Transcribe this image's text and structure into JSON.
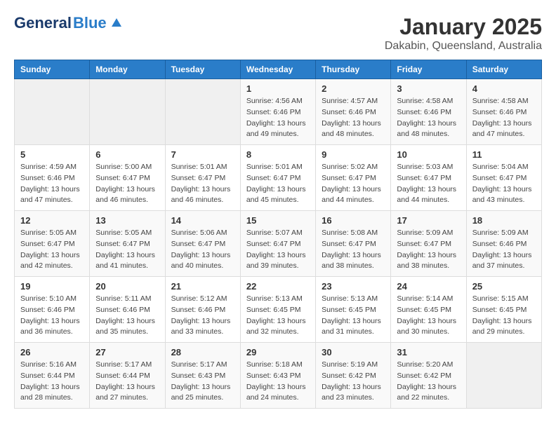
{
  "header": {
    "logo_general": "General",
    "logo_blue": "Blue",
    "month": "January 2025",
    "location": "Dakabin, Queensland, Australia"
  },
  "weekdays": [
    "Sunday",
    "Monday",
    "Tuesday",
    "Wednesday",
    "Thursday",
    "Friday",
    "Saturday"
  ],
  "weeks": [
    [
      {
        "day": "",
        "info": ""
      },
      {
        "day": "",
        "info": ""
      },
      {
        "day": "",
        "info": ""
      },
      {
        "day": "1",
        "info": "Sunrise: 4:56 AM\nSunset: 6:46 PM\nDaylight: 13 hours\nand 49 minutes."
      },
      {
        "day": "2",
        "info": "Sunrise: 4:57 AM\nSunset: 6:46 PM\nDaylight: 13 hours\nand 48 minutes."
      },
      {
        "day": "3",
        "info": "Sunrise: 4:58 AM\nSunset: 6:46 PM\nDaylight: 13 hours\nand 48 minutes."
      },
      {
        "day": "4",
        "info": "Sunrise: 4:58 AM\nSunset: 6:46 PM\nDaylight: 13 hours\nand 47 minutes."
      }
    ],
    [
      {
        "day": "5",
        "info": "Sunrise: 4:59 AM\nSunset: 6:46 PM\nDaylight: 13 hours\nand 47 minutes."
      },
      {
        "day": "6",
        "info": "Sunrise: 5:00 AM\nSunset: 6:47 PM\nDaylight: 13 hours\nand 46 minutes."
      },
      {
        "day": "7",
        "info": "Sunrise: 5:01 AM\nSunset: 6:47 PM\nDaylight: 13 hours\nand 46 minutes."
      },
      {
        "day": "8",
        "info": "Sunrise: 5:01 AM\nSunset: 6:47 PM\nDaylight: 13 hours\nand 45 minutes."
      },
      {
        "day": "9",
        "info": "Sunrise: 5:02 AM\nSunset: 6:47 PM\nDaylight: 13 hours\nand 44 minutes."
      },
      {
        "day": "10",
        "info": "Sunrise: 5:03 AM\nSunset: 6:47 PM\nDaylight: 13 hours\nand 44 minutes."
      },
      {
        "day": "11",
        "info": "Sunrise: 5:04 AM\nSunset: 6:47 PM\nDaylight: 13 hours\nand 43 minutes."
      }
    ],
    [
      {
        "day": "12",
        "info": "Sunrise: 5:05 AM\nSunset: 6:47 PM\nDaylight: 13 hours\nand 42 minutes."
      },
      {
        "day": "13",
        "info": "Sunrise: 5:05 AM\nSunset: 6:47 PM\nDaylight: 13 hours\nand 41 minutes."
      },
      {
        "day": "14",
        "info": "Sunrise: 5:06 AM\nSunset: 6:47 PM\nDaylight: 13 hours\nand 40 minutes."
      },
      {
        "day": "15",
        "info": "Sunrise: 5:07 AM\nSunset: 6:47 PM\nDaylight: 13 hours\nand 39 minutes."
      },
      {
        "day": "16",
        "info": "Sunrise: 5:08 AM\nSunset: 6:47 PM\nDaylight: 13 hours\nand 38 minutes."
      },
      {
        "day": "17",
        "info": "Sunrise: 5:09 AM\nSunset: 6:47 PM\nDaylight: 13 hours\nand 38 minutes."
      },
      {
        "day": "18",
        "info": "Sunrise: 5:09 AM\nSunset: 6:46 PM\nDaylight: 13 hours\nand 37 minutes."
      }
    ],
    [
      {
        "day": "19",
        "info": "Sunrise: 5:10 AM\nSunset: 6:46 PM\nDaylight: 13 hours\nand 36 minutes."
      },
      {
        "day": "20",
        "info": "Sunrise: 5:11 AM\nSunset: 6:46 PM\nDaylight: 13 hours\nand 35 minutes."
      },
      {
        "day": "21",
        "info": "Sunrise: 5:12 AM\nSunset: 6:46 PM\nDaylight: 13 hours\nand 33 minutes."
      },
      {
        "day": "22",
        "info": "Sunrise: 5:13 AM\nSunset: 6:45 PM\nDaylight: 13 hours\nand 32 minutes."
      },
      {
        "day": "23",
        "info": "Sunrise: 5:13 AM\nSunset: 6:45 PM\nDaylight: 13 hours\nand 31 minutes."
      },
      {
        "day": "24",
        "info": "Sunrise: 5:14 AM\nSunset: 6:45 PM\nDaylight: 13 hours\nand 30 minutes."
      },
      {
        "day": "25",
        "info": "Sunrise: 5:15 AM\nSunset: 6:45 PM\nDaylight: 13 hours\nand 29 minutes."
      }
    ],
    [
      {
        "day": "26",
        "info": "Sunrise: 5:16 AM\nSunset: 6:44 PM\nDaylight: 13 hours\nand 28 minutes."
      },
      {
        "day": "27",
        "info": "Sunrise: 5:17 AM\nSunset: 6:44 PM\nDaylight: 13 hours\nand 27 minutes."
      },
      {
        "day": "28",
        "info": "Sunrise: 5:17 AM\nSunset: 6:43 PM\nDaylight: 13 hours\nand 25 minutes."
      },
      {
        "day": "29",
        "info": "Sunrise: 5:18 AM\nSunset: 6:43 PM\nDaylight: 13 hours\nand 24 minutes."
      },
      {
        "day": "30",
        "info": "Sunrise: 5:19 AM\nSunset: 6:42 PM\nDaylight: 13 hours\nand 23 minutes."
      },
      {
        "day": "31",
        "info": "Sunrise: 5:20 AM\nSunset: 6:42 PM\nDaylight: 13 hours\nand 22 minutes."
      },
      {
        "day": "",
        "info": ""
      }
    ]
  ]
}
